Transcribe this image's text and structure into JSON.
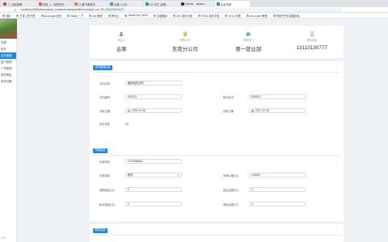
{
  "browser": {
    "tabs": [
      {
        "label": "三_加班管理"
      },
      {
        "label": "项目_1 - 阿里巴巴..."
      },
      {
        "label": "已 基于需求的..."
      },
      {
        "label": "元数 | 公司..."
      },
      {
        "label": "SG 专栏 经理..."
      },
      {
        "label": "GitHub - Jepsen..."
      },
      {
        "label": "后台系统"
      }
    ],
    "url": "localhost:8080/rtu/contract_contract/contract/editor?contract_no=TR_H31000001110",
    "bookmarks": [
      "导航",
      "已导入的书签",
      "docs.oppo/首页",
      "Baidu 一下",
      "Vue 教程",
      "腾讯云",
      "JavaScript | MDN",
      "百度翻译",
      "CSS 参考手册",
      "HTML 参考手册",
      "To Do 列表",
      "vue-router 教程",
      "阿里巴巴矢量图标库"
    ]
  },
  "sidebar": {
    "user": "古寒",
    "items": [
      "首页",
      "合同管理",
      "客户管理",
      "厂商管理",
      "事项审批",
      "系统设置"
    ],
    "active_index": 1,
    "footer": "v1.0"
  },
  "summary": [
    {
      "icon": "user-icon",
      "label": "负责人",
      "value": "古寒",
      "color": "#5b8def"
    },
    {
      "icon": "building-icon",
      "label": "所属公司",
      "value": "东莞分公司",
      "color": "#f0a839"
    },
    {
      "icon": "briefcase-icon",
      "label": "所属部门",
      "value": "第一营业部",
      "color": "#66bb6a"
    },
    {
      "icon": "phone-icon",
      "label": "联系电话",
      "value": "13113130777",
      "color": "#ef6b6b"
    }
  ],
  "card1": {
    "tag": "合同基础信息",
    "fields": {
      "name_label": "合同名称",
      "name_value": "融资租赁合同",
      "no_label": "合同编号",
      "no_value": "VIN123",
      "date_label": "开始日期",
      "date_value": "2018-11-06",
      "third_label": "附加标识",
      "third_value": "EN0321",
      "end_label": "结束日期",
      "end_value": "2017-12-18",
      "check_label": "是否续签"
    }
  },
  "card2": {
    "tag": "车辆信息",
    "fields": {
      "plate_label": "车牌号码",
      "plate_value": "TX72684582",
      "model_label": "车型选择",
      "model_value": "轿车",
      "price_label": "车辆价格(元)",
      "price_value": "120000",
      "f1_label": "首期租金(元)",
      "f1_value": "0",
      "f2_label": "保证金额(元)",
      "f2_value": "0",
      "f3_label": "每月租金(元)",
      "f3_value": "0",
      "f4_label": "尾款金额(元)",
      "f4_value": "0"
    }
  },
  "card3": {
    "tag": "附件信息"
  }
}
